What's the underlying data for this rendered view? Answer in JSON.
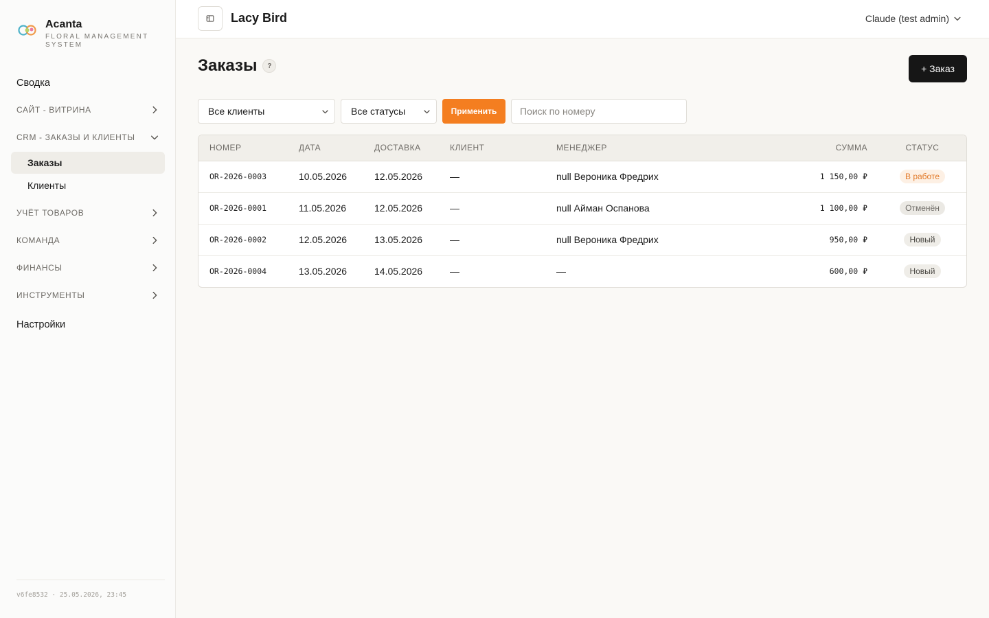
{
  "brand": {
    "name": "Acanta",
    "subtitle": "FLORAL MANAGEMENT SYSTEM"
  },
  "nav": {
    "summary": "Сводка",
    "site": "САЙТ - ВИТРИНА",
    "crm": "CRM - ЗАКАЗЫ И КЛИЕНТЫ",
    "crm_items": [
      "Заказы",
      "Клиенты"
    ],
    "inventory": "УЧЁТ ТОВАРОВ",
    "team": "КОМАНДА",
    "finance": "ФИНАНСЫ",
    "tools": "ИНСТРУМЕНТЫ",
    "settings": "Настройки"
  },
  "footer": {
    "version": "v6fe8532 · 25.05.2026, 23:45"
  },
  "topbar": {
    "shop_name": "Lacy Bird",
    "user": "Claude (test admin)"
  },
  "page": {
    "title": "Заказы",
    "help": "?",
    "new_order": "+ Заказ"
  },
  "filters": {
    "clients": "Все клиенты",
    "statuses": "Все статусы",
    "apply": "Применить",
    "search_placeholder": "Поиск по номеру"
  },
  "table": {
    "columns": [
      "НОМЕР",
      "ДАТА",
      "ДОСТАВКА",
      "КЛИЕНТ",
      "МЕНЕДЖЕР",
      "СУММА",
      "СТАТУС"
    ],
    "rows": [
      {
        "number": "OR-2026-0003",
        "date": "10.05.2026",
        "delivery": "12.05.2026",
        "client": "—",
        "manager": "null Вероника Фредрих",
        "sum": "1 150,00 ₽",
        "status": "В работе"
      },
      {
        "number": "OR-2026-0001",
        "date": "11.05.2026",
        "delivery": "12.05.2026",
        "client": "—",
        "manager": "null Айман Оспанова",
        "sum": "1 100,00 ₽",
        "status": "Отменён"
      },
      {
        "number": "OR-2026-0002",
        "date": "12.05.2026",
        "delivery": "13.05.2026",
        "client": "—",
        "manager": "null Вероника Фредрих",
        "sum": "950,00 ₽",
        "status": "Новый"
      },
      {
        "number": "OR-2026-0004",
        "date": "13.05.2026",
        "delivery": "14.05.2026",
        "client": "—",
        "manager": "—",
        "sum": "600,00 ₽",
        "status": "Новый"
      }
    ]
  },
  "colors": {
    "accent": "#f47e20",
    "primary_button": "#161616",
    "status_work": "#e27a2a"
  }
}
